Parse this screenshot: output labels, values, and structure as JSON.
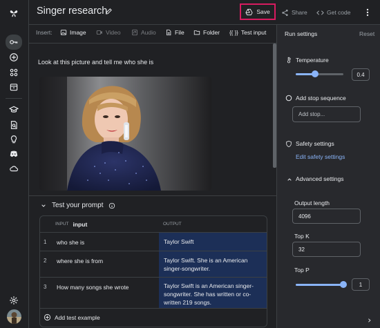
{
  "header": {
    "title": "Singer research",
    "save_label": "Save",
    "share_label": "Share",
    "get_code_label": "Get code"
  },
  "insert_bar": {
    "label": "Insert:",
    "image": "Image",
    "video": "Video",
    "audio": "Audio",
    "file": "File",
    "folder": "Folder",
    "test_input": "Test input"
  },
  "prompt": {
    "text": "Look at this picture and tell me who she is"
  },
  "test": {
    "title": "Test your prompt",
    "input_small": "INPUT",
    "input_header": "input",
    "output_header": "OUTPUT",
    "rows": [
      {
        "n": "1",
        "input": "who she is",
        "output": "Taylor Swift"
      },
      {
        "n": "2",
        "input": "where she is from",
        "output": "Taylor Swift. She is an American singer-songwriter."
      },
      {
        "n": "3",
        "input": "How many songs she wrote",
        "output": "Taylor Swift is an American singer-songwriter. She has written or co-written 219 songs."
      }
    ],
    "add_example": "Add test example"
  },
  "run_settings": {
    "title": "Run settings",
    "reset": "Reset",
    "temperature_label": "Temperature",
    "temperature_value": "0.4",
    "temperature_fraction": 0.4,
    "stop_sequence_label": "Add stop sequence",
    "stop_placeholder": "Add stop...",
    "safety_label": "Safety settings",
    "edit_safety": "Edit safety settings",
    "advanced_label": "Advanced settings",
    "output_length_label": "Output length",
    "output_length_value": "4096",
    "topk_label": "Top K",
    "topk_value": "32",
    "topp_label": "Top P",
    "topp_value": "1",
    "topp_fraction": 1.0
  },
  "colors": {
    "accent": "#8ab4f8",
    "save_highlight": "#d81b60",
    "output_bg": "#1c2f57"
  }
}
